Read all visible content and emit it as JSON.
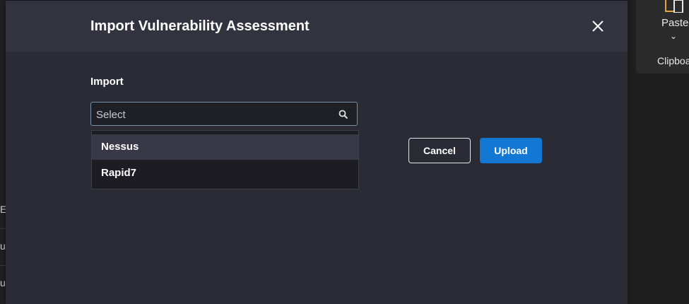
{
  "background": {
    "left_fragments": [
      "E",
      "u",
      "u"
    ]
  },
  "ribbon": {
    "paste_label": "Paste",
    "chevron": "⌄",
    "group_label": "Clipboard"
  },
  "modal": {
    "title": "Import Vulnerability Assessment",
    "close_icon": "close-icon",
    "field_label": "Import",
    "select": {
      "placeholder": "Select",
      "icon": "search-icon"
    },
    "options": [
      "Nessus",
      "Rapid7"
    ],
    "highlighted_option": "Nessus",
    "cancel_label": "Cancel",
    "upload_label": "Upload"
  },
  "colors": {
    "modal_bg": "#2b2b36",
    "header_bg": "#33333f",
    "upload_bg": "#1378d4",
    "highlight_bg": "#393846"
  }
}
